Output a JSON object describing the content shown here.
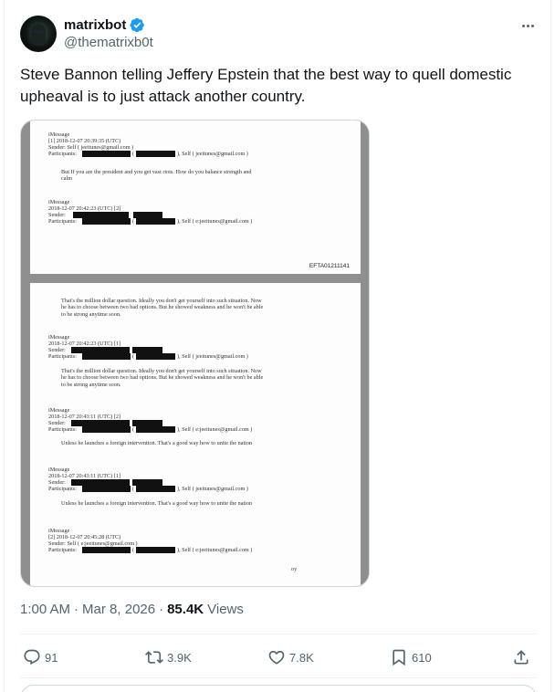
{
  "author": {
    "display_name": "matrixbot",
    "handle": "@thematrixb0t",
    "verified": true,
    "avatar_icon": "avatar-image"
  },
  "tweet": {
    "text": "Steve Bannon telling Jeffery Epstein that the best way to quell domestic upheaval is to just attack another country."
  },
  "document": {
    "page1": {
      "msg1_type": "iMessage",
      "msg1_time": "[1] 2018-12-07 20:39:35 (UTC)",
      "msg1_sender": "Sender: Self ( jeeitunes@gmail.com )",
      "msg1_participants_label": "Participants:",
      "msg1_participants_self": "), Self ( jeeitunes@gmail.com )",
      "msg1_body": "But If you are the president and you get vast riots.   How do you balance strength and\ncalm",
      "msg2_type": "iMessage",
      "msg2_time": "2018-12-07 20:42:23 (UTC) [2]",
      "msg2_sender_label": "Sender:",
      "msg2_participants_label": "Participants:",
      "msg2_participants_self": "), Self ( e:jeeitunes@gmail.com )",
      "efta_id": "EFTA01211141"
    },
    "page2": {
      "intro_body": "That's the million dollar question. Ideally you don't get yourself into such situation. Now\nhe has to choose between two bad options. But he showed weakness and he won't be able\nto be strong anytime soon.",
      "m1_type": "iMessage",
      "m1_time": "2018-12-07 20:42:23 (UTC) [1]",
      "m1_sender_label": "Sender:",
      "m1_participants_label": "Participants:",
      "m1_participants_self": "), Self ( jeeitunes@gmail.com )",
      "m1_body": "That's the million dollar question. Ideally you don't get yourself into such situation. Now\nhe has to choose between two bad options. But he showed weakness and he won't be able\nto be strong anytime soon.",
      "m2_type": "iMessage",
      "m2_time": "2018-12-07 20:43:11 (UTC) [2]",
      "m2_sender_label": "Sender:",
      "m2_participants_label": "Participants:",
      "m2_participants_self": "), Self ( e:jeeitunes@gmail.com )",
      "m2_body": "Unless he launches a foreign intervention. That's a good way how to unite the nation",
      "m3_type": "iMessage",
      "m3_time": "2018-12-07 20:43:11 (UTC) [1]",
      "m3_sender_label": "Sender:",
      "m3_participants_label": "Participants:",
      "m3_participants_self": "), Self ( jeeitunes@gmail.com )",
      "m3_body": "Unless he launches a foreign intervention. That's a good way how to unite the nation",
      "m4_type": "iMessage",
      "m4_time": "[2] 2018-12-07 20:45:28 (UTC)",
      "m4_sender": "Sender: Self ( e:jeeitunes@gmail.com )",
      "m4_participants_label": "Participants:",
      "m4_participants_self": "), Self ( e:jeeitunes@gmail.com )",
      "m4_body": "oy"
    }
  },
  "meta": {
    "time": "1:00 AM",
    "separator": "·",
    "date": "Mar 8, 2026",
    "views_count": "85.4K",
    "views_label": "Views"
  },
  "actions": {
    "replies": "91",
    "reposts": "3.9K",
    "likes": "7.8K",
    "bookmarks": "610"
  },
  "colors": {
    "verified_blue": "#1d9bf0",
    "text_primary": "#0f1419",
    "text_secondary": "#536471",
    "border": "#cfd9de"
  }
}
